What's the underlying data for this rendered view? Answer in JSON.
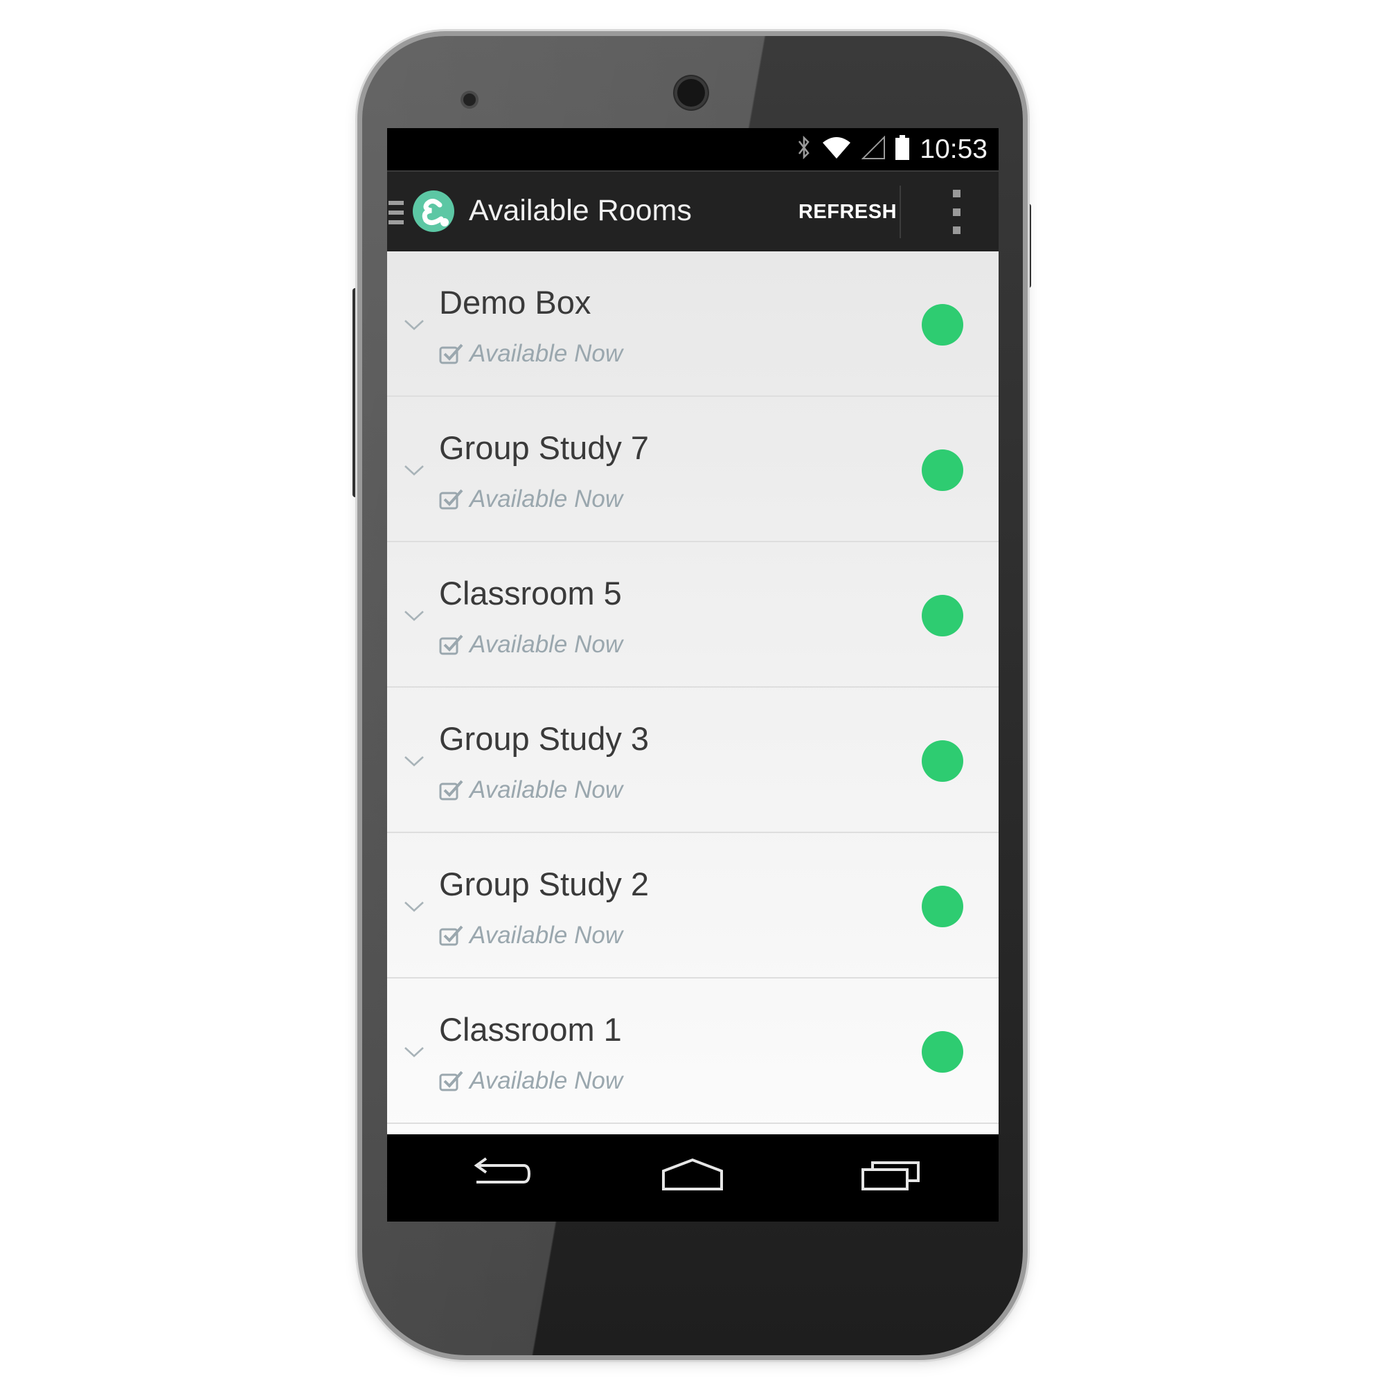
{
  "status_bar": {
    "time": "10:53",
    "icons": [
      "bluetooth-icon",
      "wifi-icon",
      "signal-icon",
      "battery-icon"
    ]
  },
  "action_bar": {
    "title": "Available Rooms",
    "refresh_label": "REFRESH",
    "icons": [
      "menu-icon",
      "app-logo-icon",
      "overflow-menu-icon"
    ]
  },
  "rooms": [
    {
      "name": "Demo Box",
      "status": "Available Now"
    },
    {
      "name": "Group Study 7",
      "status": "Available Now"
    },
    {
      "name": "Classroom 5",
      "status": "Available Now"
    },
    {
      "name": "Group Study 3",
      "status": "Available Now"
    },
    {
      "name": "Group Study 2",
      "status": "Available Now"
    },
    {
      "name": "Classroom 1",
      "status": "Available Now"
    }
  ],
  "nav_bar": {
    "icons": [
      "back-icon",
      "home-icon",
      "recents-icon"
    ]
  },
  "colors": {
    "available": "#2ecc71",
    "action_bar": "#222222",
    "logo": "#5cc7a4",
    "status_text": "#9aa7ae"
  }
}
